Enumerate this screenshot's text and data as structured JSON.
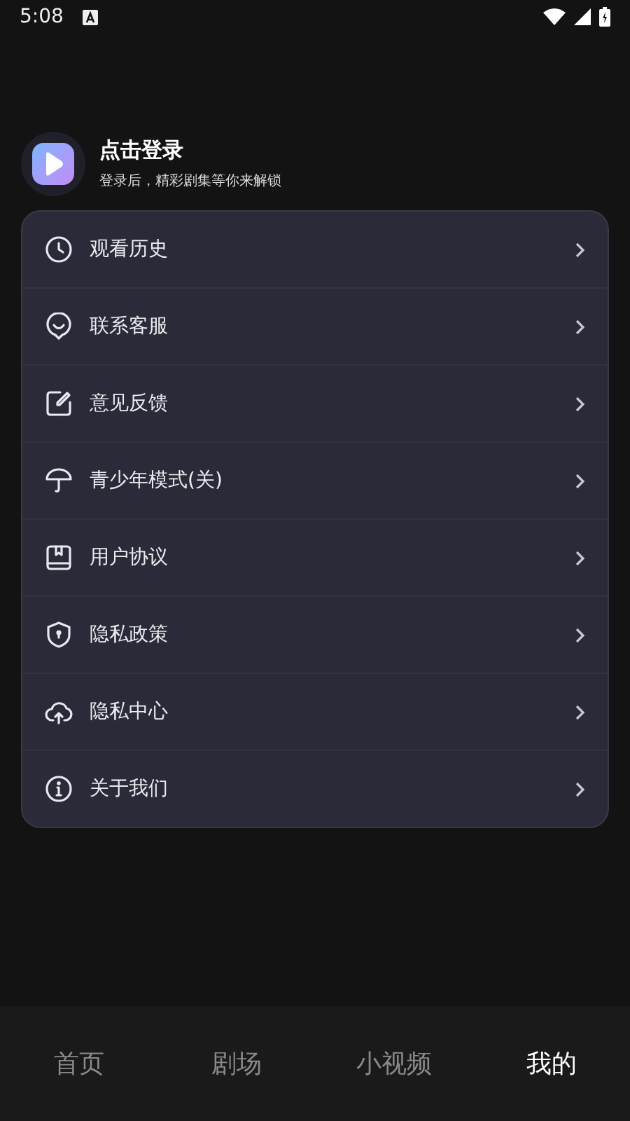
{
  "status_bar": {
    "time": "5:08"
  },
  "profile": {
    "title": "点击登录",
    "subtitle": "登录后，精彩剧集等你来解锁"
  },
  "menu": [
    {
      "kind": "clock",
      "label": "观看历史"
    },
    {
      "kind": "chat",
      "label": "联系客服"
    },
    {
      "kind": "edit",
      "label": "意见反馈"
    },
    {
      "kind": "umbrella",
      "label": "青少年模式(关)"
    },
    {
      "kind": "book",
      "label": "用户协议"
    },
    {
      "kind": "shield",
      "label": "隐私政策"
    },
    {
      "kind": "cloud",
      "label": "隐私中心"
    },
    {
      "kind": "info",
      "label": "关于我们"
    }
  ],
  "tabs": [
    {
      "label": "首页",
      "selected": false
    },
    {
      "label": "剧场",
      "selected": false
    },
    {
      "label": "小视频",
      "selected": false
    },
    {
      "label": "我的",
      "selected": true
    }
  ]
}
